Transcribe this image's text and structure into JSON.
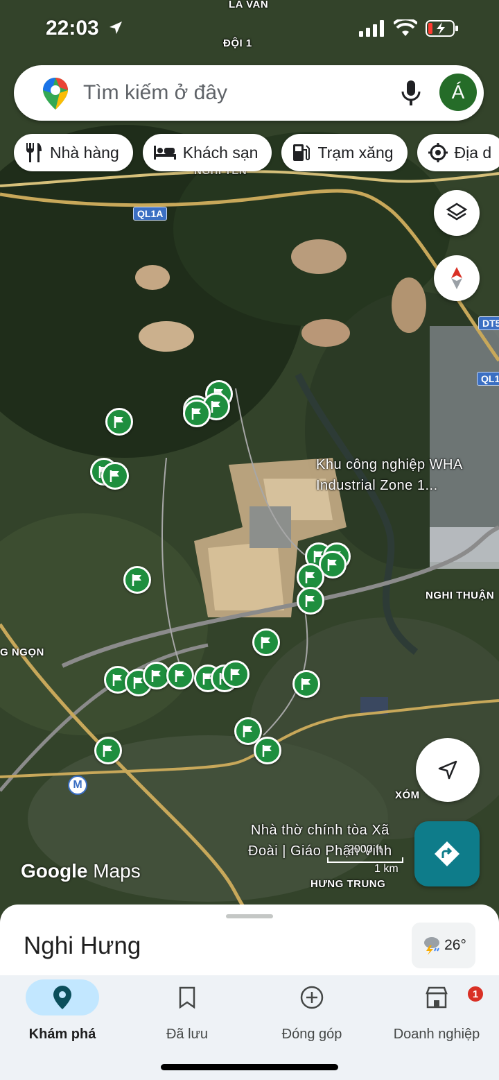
{
  "status": {
    "time": "22:03"
  },
  "search": {
    "placeholder": "Tìm kiếm ở đây",
    "avatar_letter": "Á"
  },
  "chips": [
    {
      "label": "Nhà hàng",
      "icon": "fork-knife-icon"
    },
    {
      "label": "Khách sạn",
      "icon": "bed-icon"
    },
    {
      "label": "Trạm xăng",
      "icon": "gas-station-icon"
    },
    {
      "label": "Địa d",
      "icon": "attractions-icon"
    }
  ],
  "map": {
    "labels": {
      "la_van": "LA VAN",
      "doi1": "ĐỘI 1",
      "nghi_yen": "NGHI YÊN",
      "industrial": "Khu công nghiệp WHA\nIndustrial Zone 1...",
      "nghi_thuan": "NGHI THUẬN",
      "ngon": "G NGỌN",
      "xom": "XÓM",
      "church": "Nhà thờ chính tòa Xã\nĐoài | Giáo Phận Vinh",
      "hung_trung": "HƯNG TRUNG"
    },
    "shields": {
      "ql1a": "QL1A",
      "dt5": "DT5",
      "ql1": "QL1",
      "metro": "M"
    },
    "scale": {
      "distance_ft": "2000 ft",
      "distance_km": "1 km"
    },
    "logo": {
      "google": "Google",
      "maps": "Maps"
    }
  },
  "sheet": {
    "title": "Nghi Hưng",
    "weather": "26°"
  },
  "nav": [
    {
      "label": "Khám phá",
      "icon": "location-pin-icon",
      "active": true
    },
    {
      "label": "Đã lưu",
      "icon": "bookmark-icon",
      "active": false
    },
    {
      "label": "Đóng góp",
      "icon": "add-circle-icon",
      "active": false
    },
    {
      "label": "Doanh nghiệp",
      "icon": "store-icon",
      "active": false,
      "badge": "1"
    }
  ],
  "colors": {
    "poi_green": "#1e8e3e",
    "directions_teal": "#0e7c8a",
    "nav_active": "#c2e7ff"
  }
}
